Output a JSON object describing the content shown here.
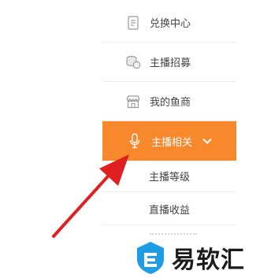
{
  "menu": {
    "items": [
      {
        "label": "兑换中心",
        "icon": "document-icon"
      },
      {
        "label": "主播招募",
        "icon": "coins-icon"
      },
      {
        "label": "我的鱼商",
        "icon": "shop-icon"
      }
    ],
    "active_item": {
      "label": "主播相关",
      "icon": "microphone-icon",
      "expanded": true
    },
    "sub_items": [
      {
        "label": "主播等级"
      },
      {
        "label": "直播收益"
      }
    ]
  },
  "colors": {
    "accent": "#f7892c",
    "arrow": "#e02020",
    "logo_blue": "#1e9ce6"
  },
  "watermark": {
    "text": "易软汇",
    "icon": "brand-logo-icon"
  }
}
